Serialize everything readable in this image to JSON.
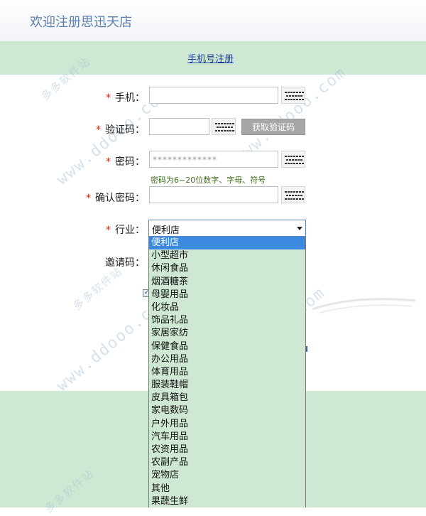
{
  "header": {
    "title": "欢迎注册思迅天店"
  },
  "tabs": {
    "phone_register": "手机号注册"
  },
  "form": {
    "required_mark": "*",
    "phone": {
      "label": "手机："
    },
    "verify_code": {
      "label": "验证码：",
      "button": "获取验证码"
    },
    "password": {
      "label": "密码：",
      "masked_value": "*************",
      "hint": "密码为6~20位数字、字母、符号"
    },
    "confirm_password": {
      "label": "确认密码："
    },
    "industry": {
      "label": "行业：",
      "selected": "便利店",
      "options": [
        "便利店",
        "小型超市",
        "休闲食品",
        "烟酒糖茶",
        "母婴用品",
        "化妆品",
        "饰品礼品",
        "家居家纺",
        "保健食品",
        "办公用品",
        "体育用品",
        "服装鞋帽",
        "皮具箱包",
        "家电数码",
        "户外用品",
        "汽车用品",
        "农资用品",
        "农副产品",
        "宠物店",
        "其他",
        "果蔬生鲜"
      ]
    },
    "invite_code": {
      "label": "邀请码："
    },
    "agree_checkbox": {
      "checked": true,
      "mark": "✓"
    }
  },
  "watermark": {
    "latin": "www.ddooo.com",
    "cn": "多多软件站"
  },
  "colors": {
    "accent_band": "#cfe8d4",
    "header_text": "#5a7fae",
    "required": "#d8261c",
    "selected_option": "#3c8ae0"
  }
}
